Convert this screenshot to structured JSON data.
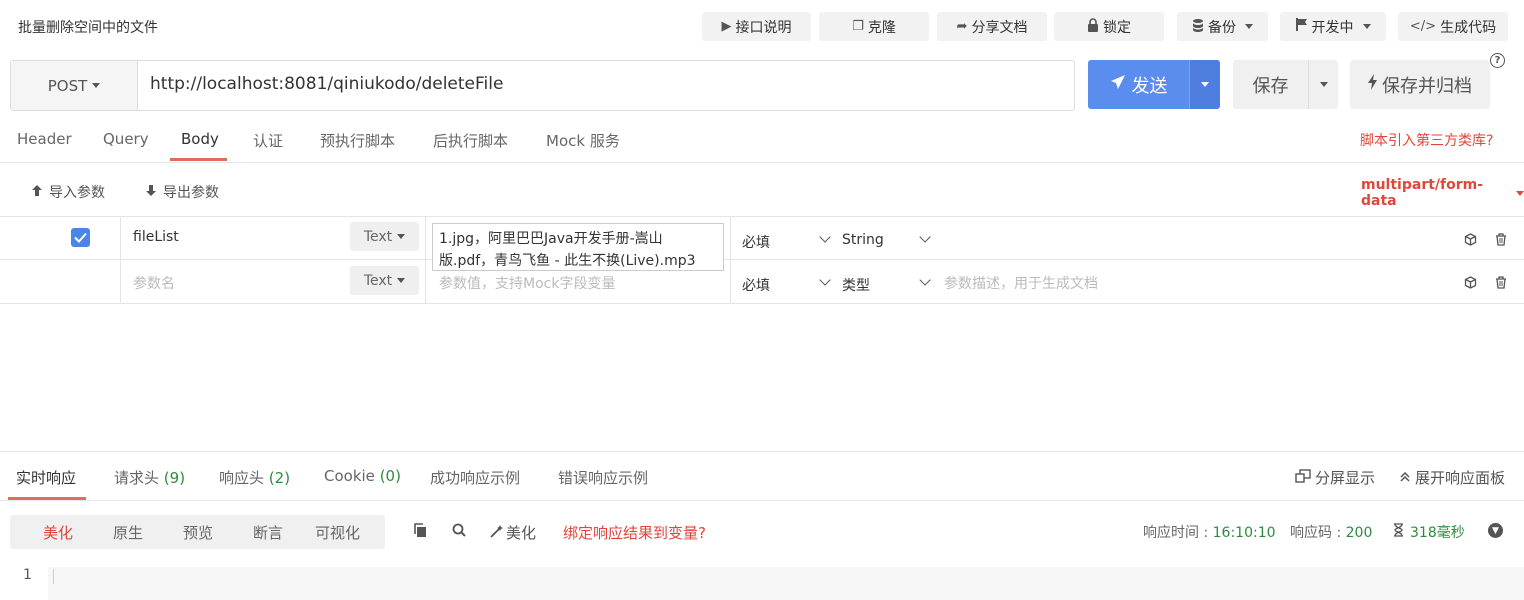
{
  "page": {
    "title": "批量删除空间中的文件"
  },
  "toolbar": {
    "api_doc": "接口说明",
    "clone": "克隆",
    "share_doc": "分享文档",
    "lock": "锁定",
    "backup": "备份",
    "status": "开发中",
    "gen_code": "生成代码"
  },
  "request": {
    "method": "POST",
    "url": "http://localhost:8081/qiniukodo/deleteFile",
    "send_label": "发送",
    "save_label": "保存",
    "save_archive_label": "保存并归档"
  },
  "tabs": {
    "items": [
      "Header",
      "Query",
      "Body",
      "认证",
      "预执行脚本",
      "后执行脚本",
      "Mock 服务"
    ],
    "active": "Body",
    "third_party": "脚本引入第三方类库?"
  },
  "body": {
    "import_label": "导入参数",
    "export_label": "导出参数",
    "content_type": "multipart/form-data",
    "rows": [
      {
        "checked": true,
        "name": "fileList",
        "type": "Text",
        "value_line1": "1.jpg，阿里巴巴Java开发手册-嵩山",
        "value_line2": "版.pdf，青鸟飞鱼 - 此生不换(Live).mp3",
        "required": "必填",
        "data_type": "String"
      },
      {
        "name_placeholder": "参数名",
        "type": "Text",
        "value_placeholder": "参数值，支持Mock字段变量",
        "required": "必填",
        "data_type_placeholder": "类型",
        "desc_placeholder": "参数描述，用于生成文档"
      }
    ]
  },
  "response": {
    "tabs": [
      {
        "label": "实时响应",
        "count": ""
      },
      {
        "label": "请求头",
        "count": "(9)"
      },
      {
        "label": "响应头",
        "count": "(2)"
      },
      {
        "label": "Cookie",
        "count": "(0)"
      },
      {
        "label": "成功响应示例",
        "count": ""
      },
      {
        "label": "错误响应示例",
        "count": ""
      }
    ],
    "split_view": "分屏显示",
    "expand_panel": "展开响应面板",
    "view_modes": [
      "美化",
      "原生",
      "预览",
      "断言",
      "可视化"
    ],
    "active_mode": "美化",
    "beautify": "美化",
    "bind_link": "绑定响应结果到变量?",
    "time_label": "响应时间 : ",
    "time_value": "16:10:10",
    "code_label": "响应码 : ",
    "code_value": "200",
    "duration": "318毫秒",
    "line_number": "1"
  },
  "colors": {
    "accent": "#5b8def",
    "danger": "#e0473c",
    "success": "#2e8b3e"
  }
}
